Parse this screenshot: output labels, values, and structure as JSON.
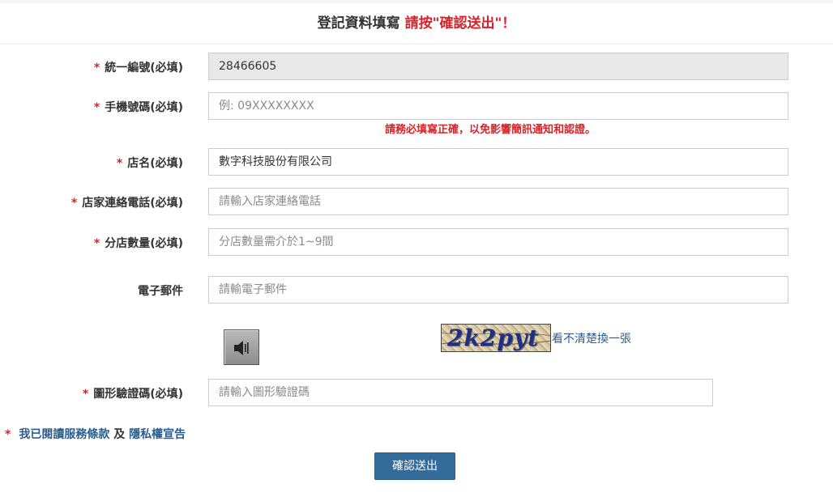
{
  "header": {
    "title": "登記資料填寫",
    "highlight": "請按\"確認送出\"！"
  },
  "form": {
    "required_mark": "*",
    "tax_id": {
      "label": "統一編號(必填)",
      "value": "28466605"
    },
    "mobile": {
      "label": "手機號碼(必填)",
      "placeholder": "例: 09XXXXXXXX",
      "hint": "請務必填寫正確，以免影響簡訊通知和認證。"
    },
    "store_name": {
      "label": "店名(必填)",
      "value": "數字科技股份有限公司"
    },
    "store_phone": {
      "label": "店家連絡電話(必填)",
      "placeholder": "請輸入店家連絡電話"
    },
    "branch_count": {
      "label": "分店數量(必填)",
      "placeholder": "分店數量需介於1~9間"
    },
    "email": {
      "label": "電子郵件",
      "placeholder": "請輸電子郵件"
    },
    "captcha": {
      "image_text": "2k2pyt",
      "refresh_label": "看不清楚換一張",
      "audio_icon": "speaker-icon",
      "label": "圖形驗證碼(必填)",
      "placeholder": "請輸入圖形驗證碼"
    }
  },
  "terms": {
    "prefix_mark": "*",
    "terms_link": "我已閱讀服務條款",
    "and": "及",
    "privacy_link": "隱私權宣告"
  },
  "submit_label": "確認送出",
  "colors": {
    "accent_red": "#d9222a",
    "link_blue": "#2a5d8f",
    "button_blue": "#336b9b"
  }
}
